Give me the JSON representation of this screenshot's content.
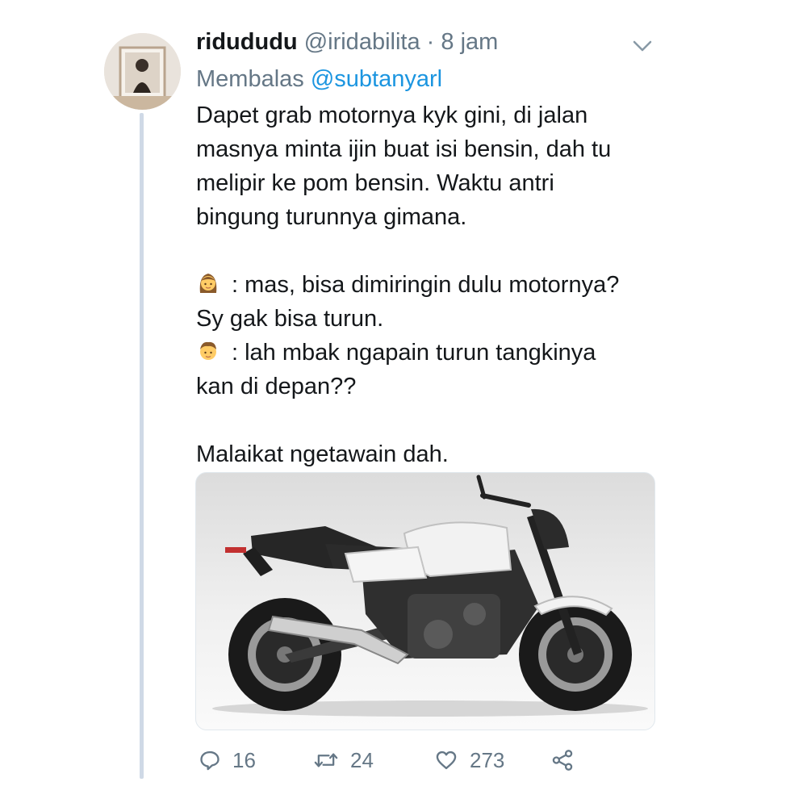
{
  "tweet": {
    "display_name": "ridududu",
    "handle": "@iridabilita",
    "separator": "·",
    "time": "8 jam",
    "reply_prefix": "Membalas",
    "reply_to": "@subtanyarl",
    "lines": [
      "Dapet grab motornya kyk gini, di jalan",
      "masnya minta ijin buat isi bensin, dah tu",
      "melipir ke pom bensin. Waktu antri",
      "bingung turunnya gimana.",
      ": mas, bisa dimiringin dulu motornya?",
      "Sy gak bisa turun.",
      ": lah mbak ngapain turun tangkinya",
      "kan di depan??",
      "Malaikat ngetawain dah."
    ],
    "emoji": [
      "woman-emoji",
      "man-emoji"
    ]
  },
  "actions": {
    "reply_count": "16",
    "retweet_count": "24",
    "like_count": "273"
  },
  "icons": [
    "chevron-down-icon",
    "reply-icon",
    "retweet-icon",
    "like-icon",
    "share-icon"
  ],
  "colors": {
    "text": "#14171a",
    "secondary": "#657786",
    "link": "#1b95e0",
    "thread_line": "#cfd9e6"
  }
}
